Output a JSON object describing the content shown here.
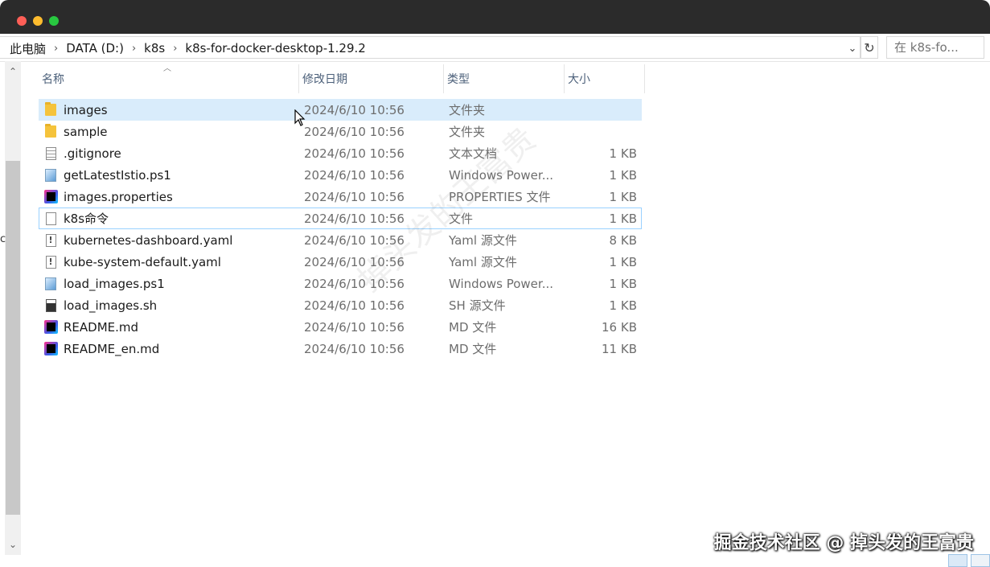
{
  "breadcrumbs": [
    "此电脑",
    "DATA (D:)",
    "k8s",
    "k8s-for-docker-desktop-1.29.2"
  ],
  "search": {
    "placeholder": "在 k8s-fo..."
  },
  "columns": {
    "name": "名称",
    "date": "修改日期",
    "type": "类型",
    "size": "大小"
  },
  "files": [
    {
      "name": "images",
      "date": "2024/6/10 10:56",
      "type": "文件夹",
      "size": "",
      "icon": "folder-icon"
    },
    {
      "name": "sample",
      "date": "2024/6/10 10:56",
      "type": "文件夹",
      "size": "",
      "icon": "folder-icon"
    },
    {
      "name": ".gitignore",
      "date": "2024/6/10 10:56",
      "type": "文本文档",
      "size": "1 KB",
      "icon": "text-file-icon"
    },
    {
      "name": "getLatestIstio.ps1",
      "date": "2024/6/10 10:56",
      "type": "Windows Power...",
      "size": "1 KB",
      "icon": "powershell-file-icon"
    },
    {
      "name": "images.properties",
      "date": "2024/6/10 10:56",
      "type": "PROPERTIES 文件",
      "size": "1 KB",
      "icon": "intellij-file-icon"
    },
    {
      "name": "k8s命令",
      "date": "2024/6/10 10:56",
      "type": "文件",
      "size": "1 KB",
      "icon": "blank-file-icon"
    },
    {
      "name": "kubernetes-dashboard.yaml",
      "date": "2024/6/10 10:56",
      "type": "Yaml 源文件",
      "size": "8 KB",
      "icon": "yaml-file-icon"
    },
    {
      "name": "kube-system-default.yaml",
      "date": "2024/6/10 10:56",
      "type": "Yaml 源文件",
      "size": "1 KB",
      "icon": "yaml-file-icon"
    },
    {
      "name": "load_images.ps1",
      "date": "2024/6/10 10:56",
      "type": "Windows Power...",
      "size": "1 KB",
      "icon": "powershell-file-icon"
    },
    {
      "name": "load_images.sh",
      "date": "2024/6/10 10:56",
      "type": "SH 源文件",
      "size": "1 KB",
      "icon": "shell-file-icon"
    },
    {
      "name": "README.md",
      "date": "2024/6/10 10:56",
      "type": "MD 文件",
      "size": "16 KB",
      "icon": "intellij-file-icon"
    },
    {
      "name": "README_en.md",
      "date": "2024/6/10 10:56",
      "type": "MD 文件",
      "size": "11 KB",
      "icon": "intellij-file-icon"
    }
  ],
  "watermark": "掉头发的王富贵",
  "credit": "掘金技术社区 @ 掉头发的王富贵",
  "left_pane_cut_text": "c",
  "colors": {
    "selection": "#cce8ff",
    "focus_outline": "#99d1ff",
    "titlebar": "#2b2b2b"
  }
}
